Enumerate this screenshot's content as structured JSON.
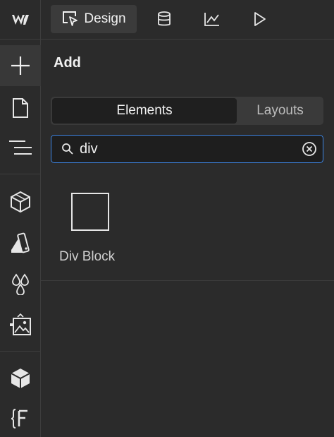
{
  "topbar": {
    "tabs": [
      {
        "label": "Design",
        "icon": "cursor-select-icon",
        "active": true
      },
      {
        "label": "",
        "icon": "database-icon",
        "active": false
      },
      {
        "label": "",
        "icon": "chart-line-icon",
        "active": false
      },
      {
        "label": "",
        "icon": "play-icon",
        "active": false
      }
    ]
  },
  "rail": {
    "logo": "webflow-logo-icon",
    "items": [
      {
        "icon": "plus-icon",
        "active": true
      },
      {
        "icon": "page-icon"
      },
      {
        "icon": "navigator-icon"
      },
      {
        "icon": "cube-icon"
      },
      {
        "icon": "style-selector-icon"
      },
      {
        "icon": "color-drops-icon"
      },
      {
        "icon": "assets-image-icon"
      },
      {
        "icon": "components-icon"
      },
      {
        "icon": "finsweet-icon"
      }
    ]
  },
  "panel": {
    "title": "Add",
    "segments": {
      "elements": "Elements",
      "layouts": "Layouts"
    },
    "search": {
      "value": "div",
      "placeholder": ""
    },
    "results": [
      {
        "label": "Div Block",
        "icon": "div-block-icon"
      }
    ]
  },
  "colors": {
    "background": "#2b2b2b",
    "accent": "#3d86e6",
    "text": "#e6e6e6"
  }
}
